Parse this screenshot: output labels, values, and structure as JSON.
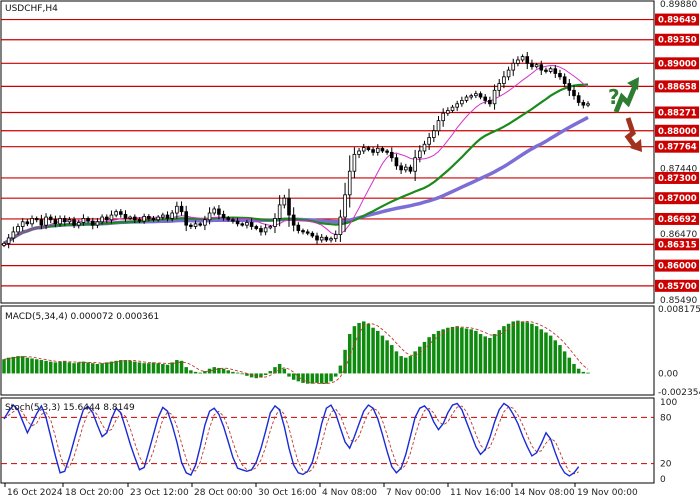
{
  "colors": {
    "level_line": "#cc0000",
    "level_tag": "#cc0000",
    "candle_up": "#ffffff",
    "candle_down": "#000000",
    "ma_fast": "#d633c8",
    "ma_mid": "#1a8a1a",
    "ma_slow": "#7b6fd6",
    "macd_hist": "#0e8a0e",
    "macd_signal": "#c0392b",
    "stoch_k": "#1a2bd6",
    "stoch_d": "#c0392b",
    "arrow_green": "#2e7d32",
    "arrow_red": "#a0321e",
    "question": "#2e7d32"
  },
  "chart_data": [
    {
      "type": "candlestick",
      "title": "USDCHF,H4",
      "ylim": [
        0.8549,
        0.8988
      ],
      "y_ticks": [
        "0.89880",
        "0.89649",
        "0.89350",
        "0.89000",
        "0.88658",
        "0.88271",
        "0.88000",
        "0.87764",
        "0.87440",
        "0.87300",
        "0.87000",
        "0.86692",
        "0.86470",
        "0.86315",
        "0.86000",
        "0.85700",
        "0.85490"
      ],
      "level_tags": [
        "0.89649",
        "0.89350",
        "0.89000",
        "0.88658",
        "0.88271",
        "0.88000",
        "0.87764",
        "0.87300",
        "0.87000",
        "0.86692",
        "0.86315",
        "0.86000",
        "0.85700"
      ],
      "levels": [
        0.89649,
        0.8935,
        0.89,
        0.88658,
        0.88271,
        0.88,
        0.87764,
        0.873,
        0.87,
        0.86692,
        0.86315,
        0.86,
        0.857
      ],
      "close": [
        0.8633,
        0.8641,
        0.865,
        0.8658,
        0.8665,
        0.8662,
        0.867,
        0.8668,
        0.866,
        0.8672,
        0.8668,
        0.8662,
        0.867,
        0.8665,
        0.8668,
        0.866,
        0.8664,
        0.867,
        0.8666,
        0.866,
        0.8665,
        0.8672,
        0.8668,
        0.8675,
        0.868,
        0.8676,
        0.867,
        0.8672,
        0.8668,
        0.8666,
        0.8673,
        0.867,
        0.8668,
        0.8672,
        0.8675,
        0.867,
        0.8678,
        0.8688,
        0.868,
        0.866,
        0.8658,
        0.8662,
        0.866,
        0.8668,
        0.8678,
        0.8684,
        0.8676,
        0.8671,
        0.8668,
        0.8666,
        0.8662,
        0.866,
        0.8664,
        0.8658,
        0.8655,
        0.865,
        0.8656,
        0.8658,
        0.867,
        0.869,
        0.87,
        0.8675,
        0.866,
        0.8652,
        0.865,
        0.8648,
        0.8644,
        0.8638,
        0.8642,
        0.8638,
        0.864,
        0.8646,
        0.8672,
        0.8705,
        0.874,
        0.8765,
        0.877,
        0.8775,
        0.8772,
        0.8768,
        0.8774,
        0.877,
        0.8768,
        0.876,
        0.8748,
        0.8742,
        0.8746,
        0.874,
        0.876,
        0.877,
        0.878,
        0.879,
        0.88,
        0.8815,
        0.8826,
        0.883,
        0.8835,
        0.884,
        0.8845,
        0.885,
        0.8852,
        0.8855,
        0.885,
        0.8845,
        0.884,
        0.886,
        0.887,
        0.888,
        0.889,
        0.89,
        0.8905,
        0.891,
        0.89,
        0.8895,
        0.8898,
        0.889,
        0.8888,
        0.8892,
        0.8885,
        0.888,
        0.887,
        0.886,
        0.8852,
        0.8842,
        0.8838,
        0.884
      ]
    },
    {
      "type": "bar",
      "title": "MACD(5,34,4) 0.000072 0.000361",
      "ylim": [
        -0.002354,
        0.008175
      ],
      "y_ticks": [
        "0.008175",
        "0.00",
        "-0.002354"
      ],
      "values": [
        0.0018,
        0.002,
        0.0021,
        0.0022,
        0.0022,
        0.002,
        0.0019,
        0.0018,
        0.0017,
        0.0016,
        0.0015,
        0.0014,
        0.0015,
        0.0016,
        0.0014,
        0.0013,
        0.0014,
        0.0015,
        0.0014,
        0.0013,
        0.0012,
        0.0013,
        0.0014,
        0.0015,
        0.0016,
        0.0017,
        0.0017,
        0.0016,
        0.0015,
        0.0014,
        0.0013,
        0.0013,
        0.0014,
        0.0013,
        0.0012,
        0.0011,
        0.0014,
        0.0017,
        0.0016,
        0.0008,
        0.0004,
        0.0002,
        0.0001,
        0.0003,
        0.0006,
        0.0008,
        0.0007,
        0.0006,
        0.0004,
        0.0002,
        0.0001,
        0.0,
        -0.0003,
        -0.0005,
        -0.0006,
        -0.0005,
        -0.0002,
        0.0003,
        0.0008,
        0.0012,
        0.0006,
        -0.0004,
        -0.0008,
        -0.001,
        -0.0012,
        -0.0013,
        -0.0013,
        -0.0012,
        -0.0013,
        -0.0013,
        -0.001,
        -0.0004,
        0.001,
        0.003,
        0.005,
        0.006,
        0.0064,
        0.0066,
        0.0063,
        0.0058,
        0.0054,
        0.0048,
        0.0042,
        0.0036,
        0.0028,
        0.0022,
        0.002,
        0.0022,
        0.0028,
        0.0034,
        0.004,
        0.0046,
        0.005,
        0.0054,
        0.0056,
        0.0058,
        0.0059,
        0.006,
        0.0058,
        0.0057,
        0.0056,
        0.0054,
        0.005,
        0.0047,
        0.0045,
        0.005,
        0.0055,
        0.006,
        0.0063,
        0.0066,
        0.0067,
        0.0066,
        0.0065,
        0.0063,
        0.006,
        0.0056,
        0.0052,
        0.0048,
        0.0042,
        0.0036,
        0.0028,
        0.002,
        0.0012,
        0.0006,
        0.0002,
        0.0001
      ]
    },
    {
      "type": "line",
      "title": "Stoch(5,3,3) 15.6444 8.8149",
      "ylim": [
        0,
        100
      ],
      "y_ticks": [
        "100",
        "80",
        "20",
        "0"
      ],
      "levels": [
        80,
        20
      ],
      "values": [
        78,
        88,
        96,
        90,
        75,
        60,
        72,
        85,
        95,
        80,
        55,
        30,
        8,
        10,
        28,
        50,
        72,
        90,
        94,
        86,
        70,
        55,
        60,
        78,
        92,
        86,
        66,
        46,
        28,
        12,
        15,
        36,
        58,
        80,
        93,
        88,
        70,
        48,
        22,
        8,
        5,
        18,
        42,
        70,
        88,
        92,
        84,
        68,
        48,
        28,
        14,
        12,
        10,
        12,
        22,
        40,
        62,
        86,
        95,
        90,
        68,
        40,
        18,
        8,
        6,
        10,
        22,
        45,
        72,
        92,
        96,
        85,
        66,
        48,
        40,
        55,
        72,
        88,
        96,
        92,
        78,
        58,
        36,
        16,
        8,
        14,
        32,
        56,
        80,
        92,
        95,
        88,
        74,
        64,
        72,
        86,
        96,
        98,
        90,
        74,
        58,
        42,
        32,
        38,
        54,
        74,
        90,
        98,
        94,
        84,
        72,
        56,
        42,
        30,
        34,
        46,
        60,
        52,
        34,
        18,
        8,
        4,
        8,
        16
      ]
    }
  ],
  "x_labels": [
    "16 Oct 2024",
    "18 Oct 20:00",
    "23 Oct 12:00",
    "28 Oct 00:00",
    "30 Oct 16:00",
    "4 Nov 08:00",
    "7 Nov 00:00",
    "11 Nov 16:00",
    "14 Nov 08:00",
    "19 Nov 00:00"
  ],
  "annotation": "?"
}
